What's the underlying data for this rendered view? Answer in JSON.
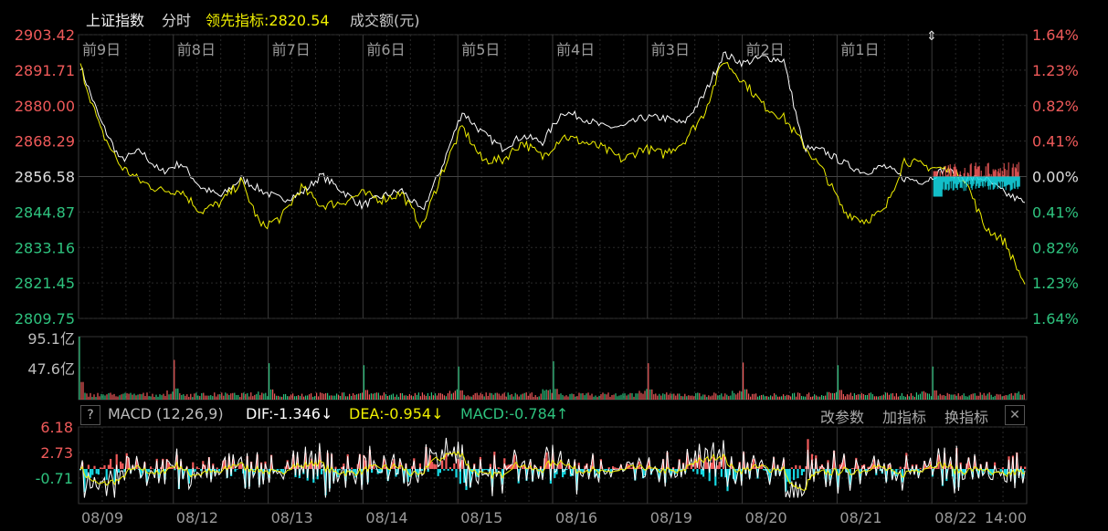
{
  "header": {
    "title": "上证指数",
    "period": "分时",
    "lead_label": "领先指标:2820.54",
    "volume_label": "成交额(元)"
  },
  "price_axis": {
    "left_ticks": [
      "2903.42",
      "2891.71",
      "2880.00",
      "2868.29",
      "2856.58",
      "2844.87",
      "2833.16",
      "2821.45",
      "2809.75"
    ],
    "right_ticks": [
      "1.64%",
      "1.23%",
      "0.82%",
      "0.41%",
      "0.00%",
      "0.41%",
      "0.82%",
      "1.23%",
      "1.64%"
    ]
  },
  "day_labels": [
    "前9日",
    "前8日",
    "前7日",
    "前6日",
    "前5日",
    "前4日",
    "前3日",
    "前2日",
    "前1日"
  ],
  "volume_axis": {
    "ticks": [
      "95.1亿",
      "47.6亿"
    ]
  },
  "macd": {
    "help": "?",
    "name": "MACD (12,26,9)",
    "dif": "DIF:-1.346↓",
    "dea": "DEA:-0.954↓",
    "macd_value": "MACD:-0.784↑",
    "buttons": [
      "改参数",
      "加指标",
      "换指标"
    ],
    "close": "✕",
    "ticks": [
      "6.18",
      "2.73",
      "-0.71"
    ]
  },
  "date_labels": [
    "08/09",
    "08/12",
    "08/13",
    "08/14",
    "08/15",
    "08/16",
    "08/19",
    "08/20",
    "08/21",
    "08/22",
    "14:00"
  ],
  "colors": {
    "up": "#f05a5a",
    "down": "#2ec27e",
    "price_line": "#ffffff",
    "lead_line": "#f0f000",
    "macd_neg": "#16d9e3",
    "grid": "#2a2a2a"
  },
  "chart_data": {
    "type": "line",
    "title": "上证指数 分时",
    "ylim": [
      2809.75,
      2903.42
    ],
    "pre_close": 2856.58,
    "days": [
      "08/09",
      "08/12",
      "08/13",
      "08/14",
      "08/15",
      "08/16",
      "08/19",
      "08/20",
      "08/21",
      "08/22"
    ],
    "series": [
      {
        "name": "上证指数",
        "values": [
          2893,
          2875,
          2862,
          2865,
          2858,
          2861,
          2853,
          2850,
          2856,
          2852,
          2849,
          2851,
          2857,
          2852,
          2847,
          2850,
          2852,
          2845,
          2860,
          2878,
          2871,
          2866,
          2870,
          2868,
          2878,
          2876,
          2873,
          2873,
          2876,
          2876,
          2874,
          2883,
          2897,
          2894,
          2896,
          2895,
          2866,
          2865,
          2861,
          2858,
          2860,
          2856,
          2855,
          2859,
          2856,
          2856,
          2851,
          2848
        ]
      },
      {
        "name": "领先指标",
        "values": [
          2893,
          2872,
          2860,
          2855,
          2852,
          2852,
          2845,
          2848,
          2855,
          2840,
          2843,
          2853,
          2847,
          2848,
          2851,
          2849,
          2851,
          2840,
          2858,
          2873,
          2862,
          2862,
          2868,
          2863,
          2870,
          2868,
          2866,
          2862,
          2866,
          2864,
          2868,
          2877,
          2895,
          2888,
          2880,
          2876,
          2867,
          2858,
          2845,
          2842,
          2845,
          2862,
          2860,
          2859,
          2856,
          2840,
          2835,
          2821
        ]
      }
    ],
    "volume": {
      "ylim": [
        0,
        95.1
      ],
      "unit": "亿",
      "day_open_peaks": [
        95.1,
        60,
        55,
        52,
        50,
        58,
        55,
        56,
        52,
        50
      ]
    },
    "macd": {
      "ylim": [
        -0.71,
        6.18
      ],
      "dif": -1.346,
      "dea": -0.954,
      "macd": -0.784
    }
  }
}
